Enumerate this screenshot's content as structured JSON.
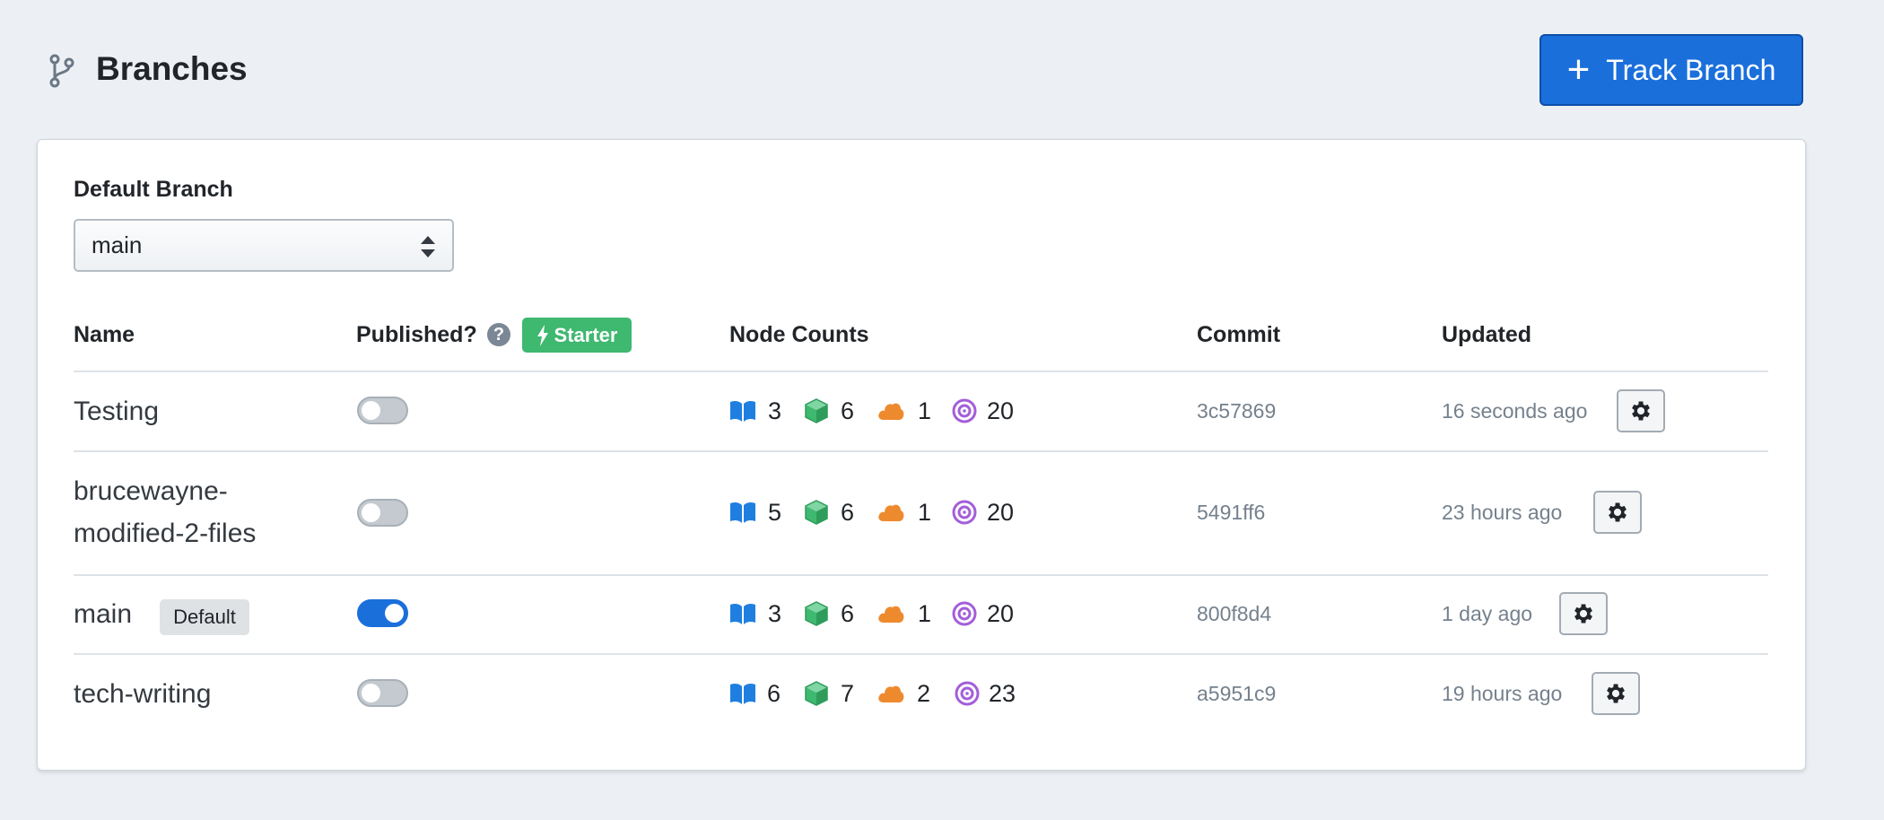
{
  "header": {
    "title": "Branches",
    "track_button_label": "Track Branch"
  },
  "default_branch": {
    "label": "Default Branch",
    "selected": "main"
  },
  "table": {
    "columns": {
      "name": "Name",
      "published": "Published?",
      "node_counts": "Node Counts",
      "commit": "Commit",
      "updated": "Updated"
    },
    "starter_badge": "Starter",
    "rows": [
      {
        "name": "Testing",
        "published": false,
        "counts": [
          "3",
          "6",
          "1",
          "20"
        ],
        "commit": "3c57869",
        "updated": "16 seconds ago"
      },
      {
        "name_line1": "brucewayne-",
        "name_line2": "modified-2-files",
        "published": false,
        "counts": [
          "5",
          "6",
          "1",
          "20"
        ],
        "commit": "5491ff6",
        "updated": "23 hours ago"
      },
      {
        "name": "main",
        "badge": "Default",
        "published": true,
        "counts": [
          "3",
          "6",
          "1",
          "20"
        ],
        "commit": "800f8d4",
        "updated": "1 day ago"
      },
      {
        "name": "tech-writing",
        "published": false,
        "counts": [
          "6",
          "7",
          "2",
          "23"
        ],
        "commit": "a5951c9",
        "updated": "19 hours ago"
      }
    ]
  },
  "icons": {
    "node_count_types": [
      "book-icon",
      "cube-icon",
      "cloud-icon",
      "target-icon"
    ]
  },
  "colors": {
    "primary": "#1a6fdb",
    "starter": "#3fb870",
    "book": "#1f7fe0",
    "cube": "#3fb870",
    "cloud": "#ee8a2e",
    "target": "#a35ed9"
  }
}
